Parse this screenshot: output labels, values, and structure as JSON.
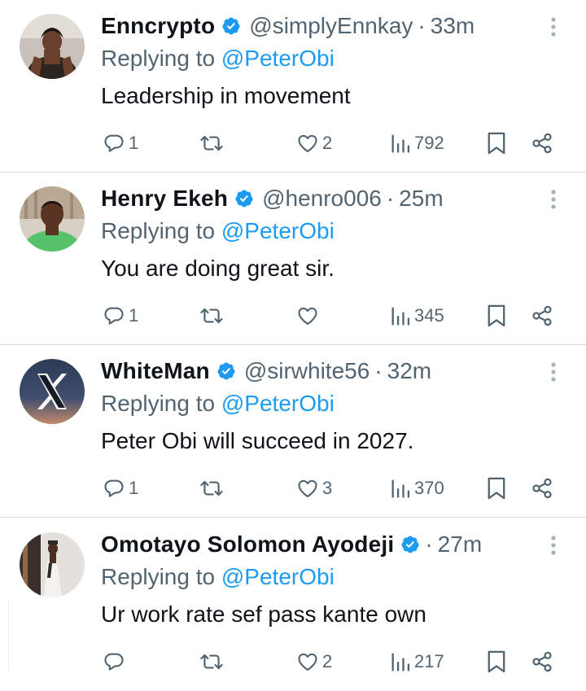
{
  "replying_label": "Replying to",
  "replies": [
    {
      "display_name": "Enncrypto",
      "handle": "@simplyEnnkay",
      "separator": "·",
      "time": "33m",
      "reply_to": "@PeterObi",
      "text": "Leadership in movement",
      "reply_count": "1",
      "repost_count": "",
      "like_count": "2",
      "view_count": "792"
    },
    {
      "display_name": "Henry Ekeh",
      "handle": "@henro006",
      "separator": "·",
      "time": "25m",
      "reply_to": "@PeterObi",
      "text": "You are doing great sir.",
      "reply_count": "1",
      "repost_count": "",
      "like_count": "",
      "view_count": "345"
    },
    {
      "display_name": "WhiteMan",
      "handle": "@sirwhite56",
      "separator": "·",
      "time": "32m",
      "reply_to": "@PeterObi",
      "text": "Peter Obi will succeed in 2027.",
      "reply_count": "1",
      "repost_count": "",
      "like_count": "3",
      "view_count": "370"
    },
    {
      "display_name": "Omotayo Solomon Ayodeji",
      "handle": "",
      "separator": "·",
      "time": "27m",
      "reply_to": "@PeterObi",
      "text": "Ur work rate sef pass kante own",
      "reply_count": "",
      "repost_count": "",
      "like_count": "2",
      "view_count": "217"
    }
  ],
  "icons": {
    "verified": "verified-badge-icon",
    "more": "more-vertical-icon",
    "reply": "reply-icon",
    "repost": "repost-icon",
    "like": "heart-icon",
    "views": "views-icon",
    "bookmark": "bookmark-icon",
    "share": "share-icon"
  },
  "colors": {
    "text": "#0f1419",
    "secondary": "#536471",
    "mention": "#1d9bf0",
    "verified": "#1d9bf0",
    "divider": "#d9dee2"
  }
}
